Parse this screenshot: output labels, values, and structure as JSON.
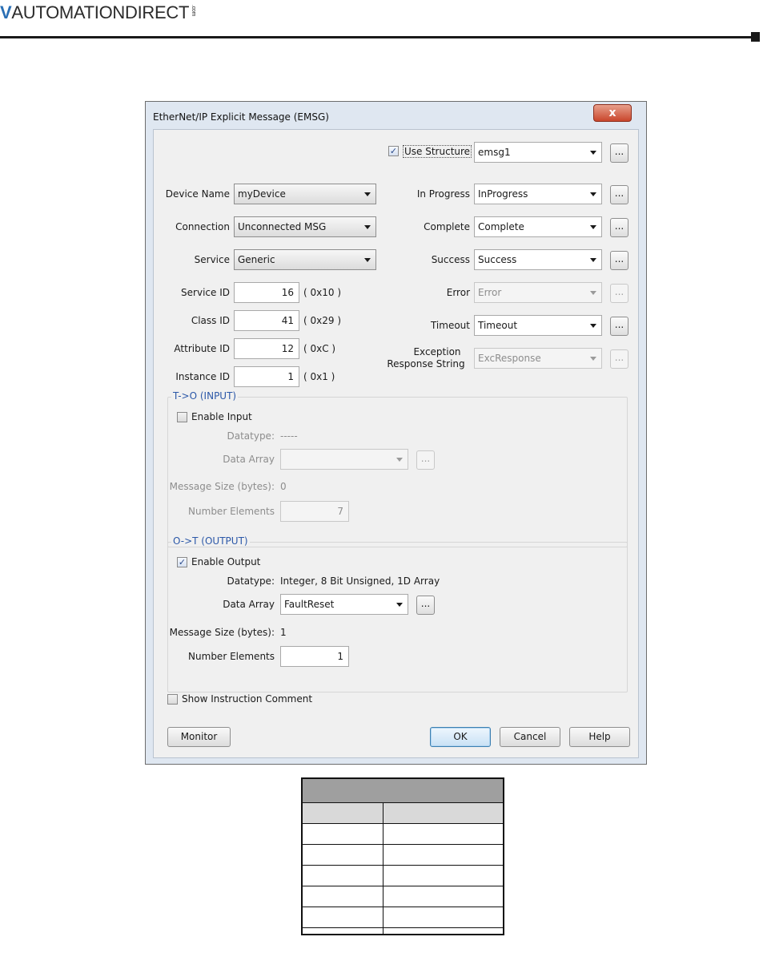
{
  "header": {
    "brand_mark": "V",
    "brand_text": "AUTOMATIONDIRECT",
    "brand_com": ".com"
  },
  "dialog": {
    "title": "EtherNet/IP Explicit Message (EMSG)",
    "close_glyph": "x",
    "use_structure": {
      "label": "Use Structure",
      "checked": true,
      "check_glyph": "✓",
      "value": "emsg1"
    },
    "ellipsis": "...",
    "left_fields": {
      "device_name": {
        "label": "Device Name",
        "value": "myDevice"
      },
      "connection": {
        "label": "Connection",
        "value": "Unconnected MSG"
      },
      "service": {
        "label": "Service",
        "value": "Generic"
      },
      "service_id": {
        "label": "Service ID",
        "value": "16",
        "hex": "( 0x10 )"
      },
      "class_id": {
        "label": "Class ID",
        "value": "41",
        "hex": "( 0x29 )"
      },
      "attribute_id": {
        "label": "Attribute ID",
        "value": "12",
        "hex": "( 0xC )"
      },
      "instance_id": {
        "label": "Instance ID",
        "value": "1",
        "hex": "( 0x1 )"
      }
    },
    "right_fields": {
      "in_progress": {
        "label": "In Progress",
        "value": "InProgress"
      },
      "complete": {
        "label": "Complete",
        "value": "Complete"
      },
      "success": {
        "label": "Success",
        "value": "Success"
      },
      "error": {
        "label": "Error",
        "value": "Error"
      },
      "timeout": {
        "label": "Timeout",
        "value": "Timeout"
      },
      "exception_line1": "Exception",
      "exception_line2": "Response String",
      "exception_value": "ExcResponse"
    },
    "input_group": {
      "title": "T->O (INPUT)",
      "enable_label": "Enable Input",
      "enabled": false,
      "datatype_label": "Datatype:",
      "datatype_value": "-----",
      "data_array_label": "Data Array",
      "data_array_value": "",
      "message_size_label": "Message Size (bytes):",
      "message_size_value": "0",
      "number_elements_label": "Number Elements",
      "number_elements_value": "7"
    },
    "output_group": {
      "title": "O->T (OUTPUT)",
      "enable_label": "Enable Output",
      "enabled": true,
      "datatype_label": "Datatype:",
      "datatype_value": "Integer, 8 Bit Unsigned, 1D Array",
      "data_array_label": "Data Array",
      "data_array_value": "FaultReset",
      "message_size_label": "Message Size (bytes):",
      "message_size_value": "1",
      "number_elements_label": "Number Elements",
      "number_elements_value": "1"
    },
    "show_comment": {
      "label": "Show Instruction Comment",
      "checked": false
    },
    "buttons": {
      "monitor": "Monitor",
      "ok": "OK",
      "cancel": "Cancel",
      "help": "Help"
    }
  },
  "colors": {
    "group_title": "#2c58a8",
    "dialog_frame": "#dfe7f1",
    "close_button": "#c9462c",
    "table_header": "#9f9f9f",
    "table_subheader": "#d9d9d9"
  }
}
